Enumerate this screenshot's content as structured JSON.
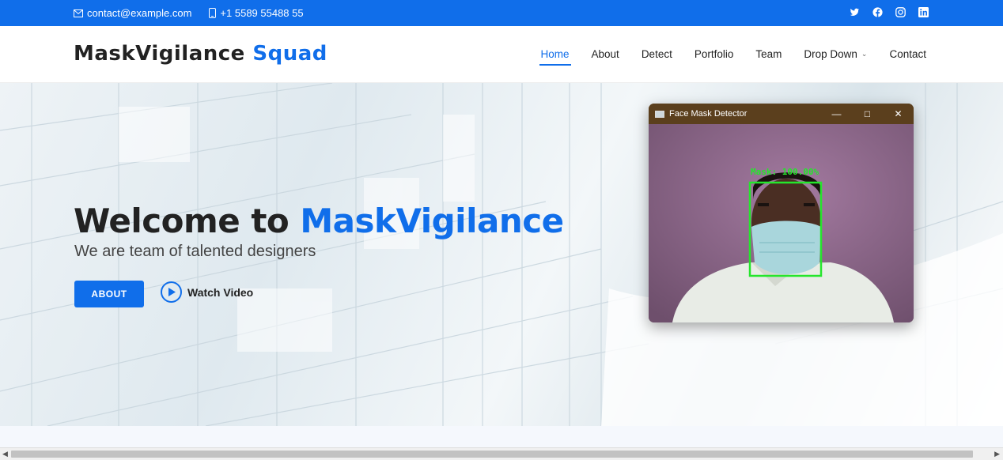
{
  "topbar": {
    "email": "contact@example.com",
    "phone": "+1 5589 55488 55",
    "social": [
      "twitter-icon",
      "facebook-icon",
      "instagram-icon",
      "linkedin-icon"
    ]
  },
  "header": {
    "logo_main": "MaskVigilance",
    "logo_accent": "Squad",
    "nav": [
      {
        "label": "Home",
        "active": true
      },
      {
        "label": "About"
      },
      {
        "label": "Detect"
      },
      {
        "label": "Portfolio"
      },
      {
        "label": "Team"
      },
      {
        "label": "Drop Down",
        "dropdown": true
      },
      {
        "label": "Contact"
      }
    ]
  },
  "hero": {
    "title_main": "Welcome to",
    "title_accent": "MaskVigilance",
    "subtitle": "We are team of talented designers",
    "about_button": "ABOUT",
    "watch_video": "Watch Video"
  },
  "detector_window": {
    "title": "Face Mask Detector",
    "detection_label": "Mask: 100.00%",
    "controls": [
      "minimize-icon",
      "maximize-icon",
      "close-icon"
    ]
  },
  "colors": {
    "accent": "#106eea",
    "detection_box": "#25e62c",
    "window_titlebar": "#5b3f1d"
  }
}
